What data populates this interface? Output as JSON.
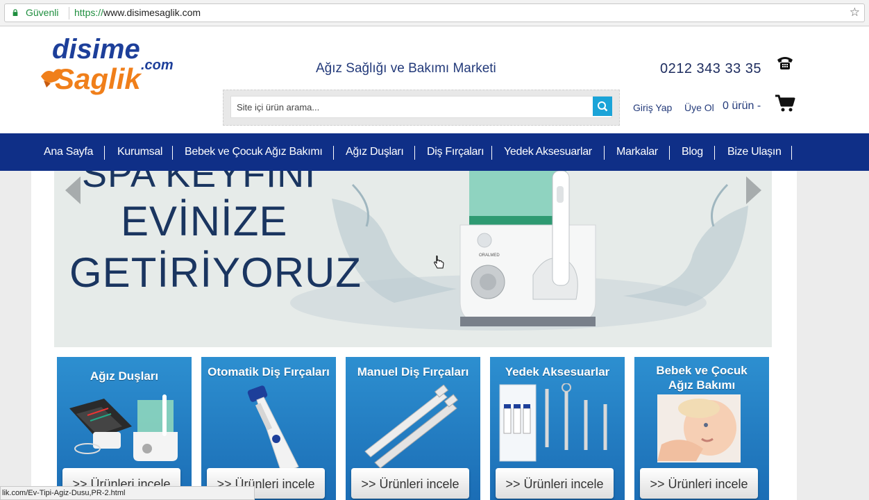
{
  "browser": {
    "secure_label": "Güvenli",
    "url_scheme": "https://",
    "url_host": "www.disimesaglik.com"
  },
  "header": {
    "logo_top": "disime",
    "logo_com": ".com",
    "logo_bottom": "Saglik",
    "tagline": "Ağız Sağlığı ve Bakımı Marketi",
    "phone": "0212 343 33 35",
    "search_placeholder": "Site içi ürün arama...",
    "login": "Giriş Yap",
    "register": "Üye Ol",
    "cart_count": "0 ürün -"
  },
  "nav": {
    "items": [
      {
        "label": "Ana Sayfa"
      },
      {
        "label": "Kurumsal"
      },
      {
        "label": "Bebek ve Çocuk Ağız Bakımı"
      },
      {
        "label": "Ağız Duşları"
      },
      {
        "label": "Diş Fırçaları"
      },
      {
        "label": "Yedek Aksesuarlar"
      },
      {
        "label": "Markalar"
      },
      {
        "label": "Blog"
      },
      {
        "label": "Bize Ulaşın"
      }
    ]
  },
  "banner": {
    "line0": "SPA KEYFİNİ",
    "line1": "EVİNİZE",
    "line2": "GETİRİYORUZ",
    "device_brand": "ORALMED"
  },
  "categories": [
    {
      "title": "Ağız Duşları",
      "button": ">> Ürünleri incele"
    },
    {
      "title": "Otomatik Diş Fırçaları",
      "button": ">> Ürünleri incele"
    },
    {
      "title": "Manuel Diş Fırçaları",
      "button": ">> Ürünleri incele"
    },
    {
      "title": "Yedek Aksesuarlar",
      "button": ">> Ürünleri incele"
    },
    {
      "title_line1": "Bebek ve Çocuk",
      "title_line2": "Ağız Bakımı",
      "button": ">> Ürünleri incele"
    }
  ],
  "status_bar": {
    "text": "lik.com/Ev-Tipi-Agiz-Dusu,PR-2.html"
  },
  "colors": {
    "nav_bg": "#0f2f87",
    "accent_blue": "#1ba4d8",
    "logo_blue": "#1d3f9a",
    "logo_orange": "#f07f1a",
    "secure_green": "#1e8e3e"
  }
}
